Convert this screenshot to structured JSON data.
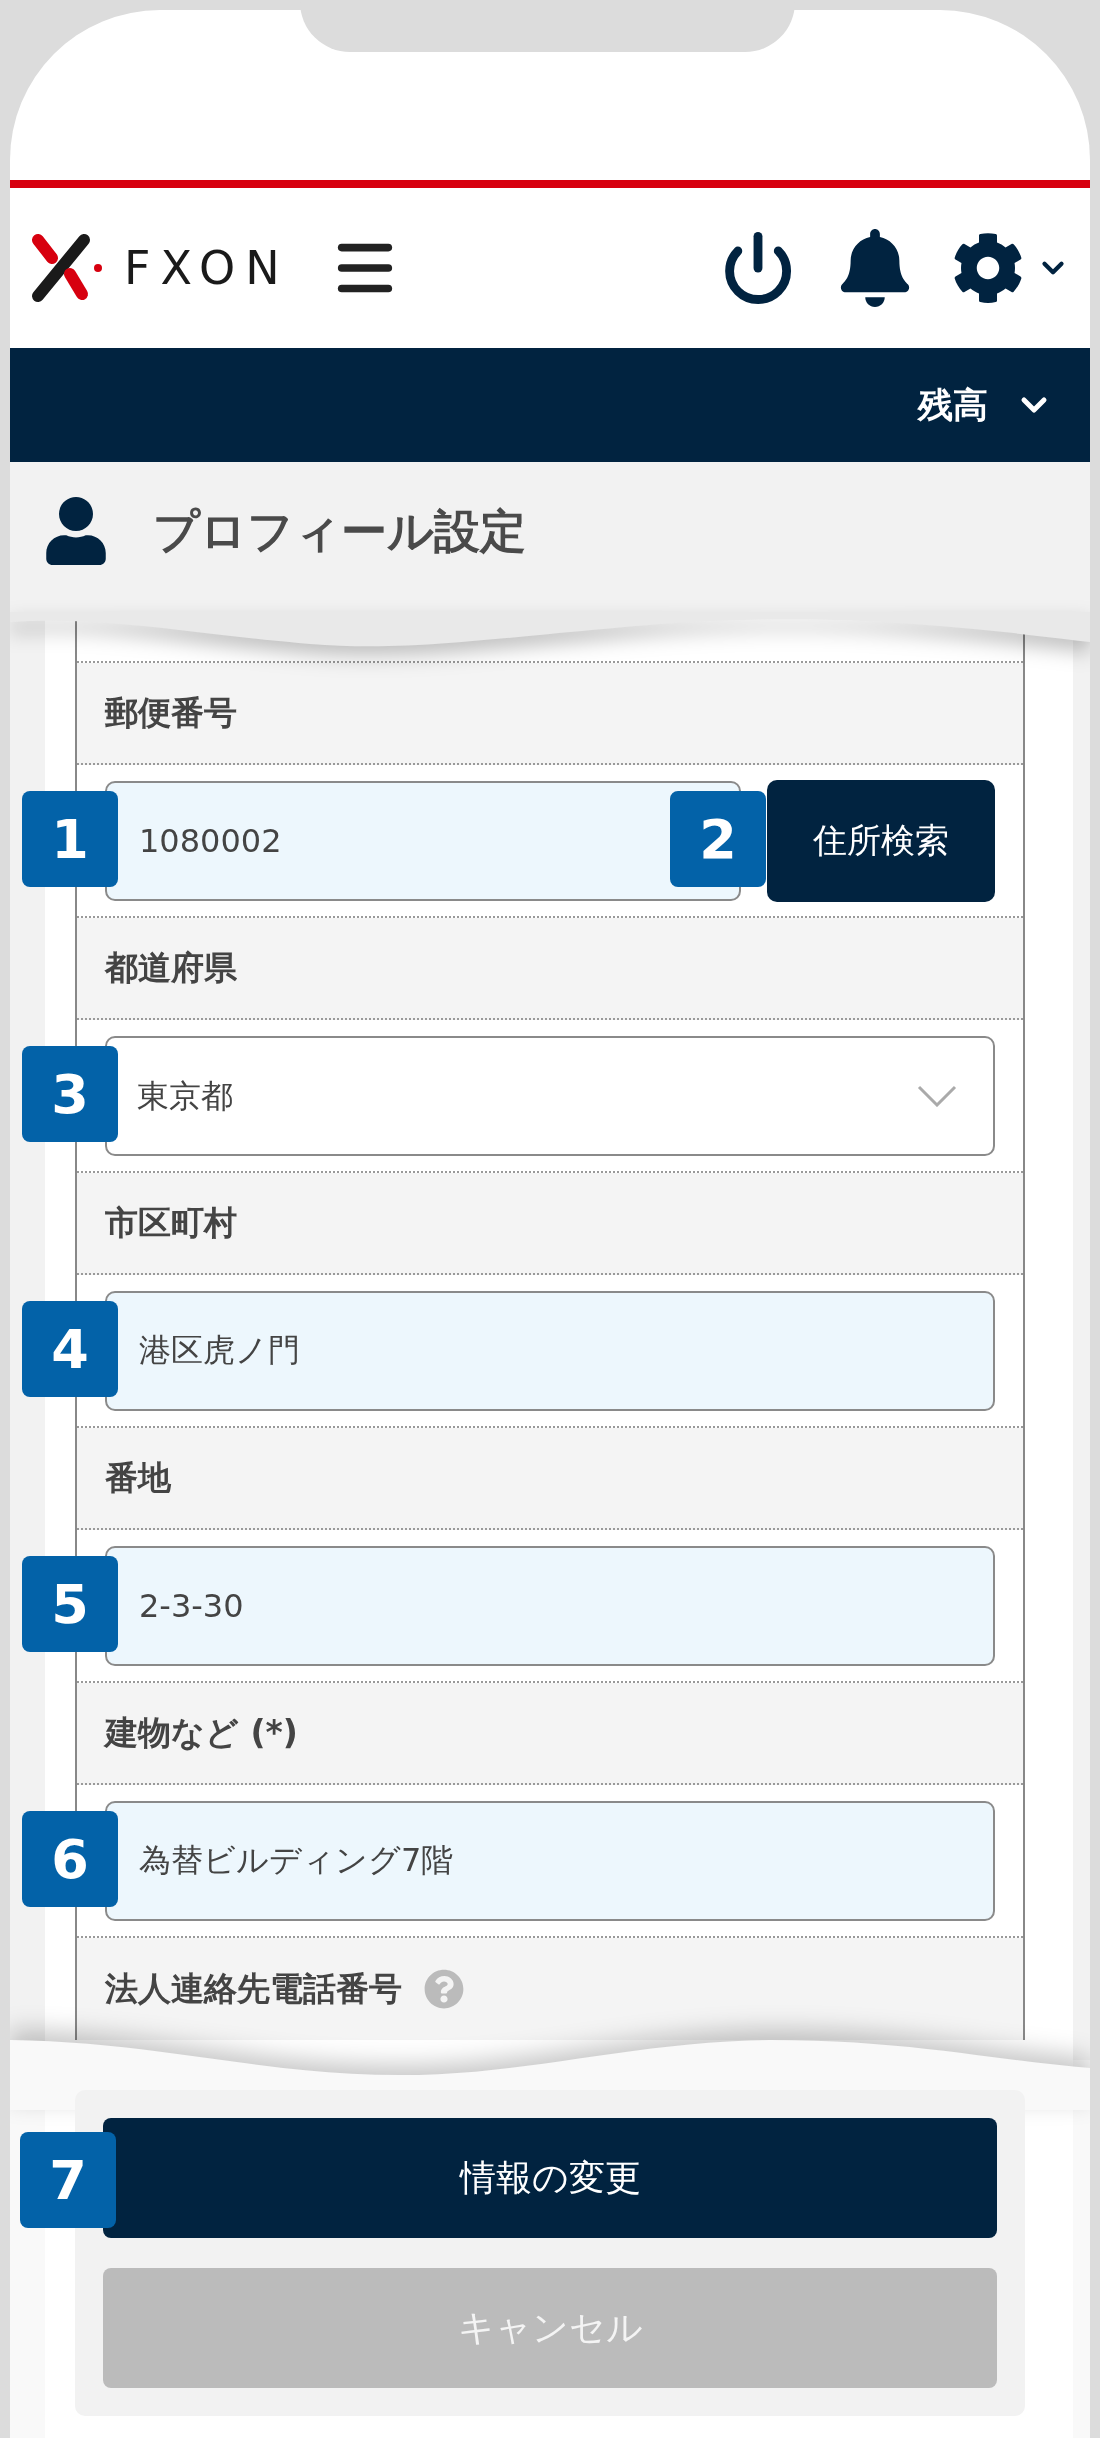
{
  "header": {
    "logo": "FXON"
  },
  "nav": {
    "balance_label": "残高"
  },
  "page_title": "プロフィール設定",
  "fields": [
    {
      "label": "郵便番号",
      "kind": "text",
      "value": "1080002",
      "badge": "1",
      "button": {
        "label": "住所検索",
        "badge": "2"
      }
    },
    {
      "label": "都道府県",
      "kind": "select",
      "value": "東京都",
      "badge": "3"
    },
    {
      "label": "市区町村",
      "kind": "text",
      "value": "港区虎ノ門",
      "badge": "4"
    },
    {
      "label": "番地",
      "kind": "text",
      "value": "2-3-30",
      "badge": "5"
    },
    {
      "label": "建物など (*)",
      "kind": "text",
      "value": "為替ビルディング7階",
      "badge": "6"
    }
  ],
  "last_label": {
    "label": "法人連絡先電話番号",
    "help": true
  },
  "actions": [
    {
      "label": "情報の変更",
      "kind": "primary",
      "badge": "7"
    },
    {
      "label": "キャンセル",
      "kind": "secondary"
    }
  ]
}
